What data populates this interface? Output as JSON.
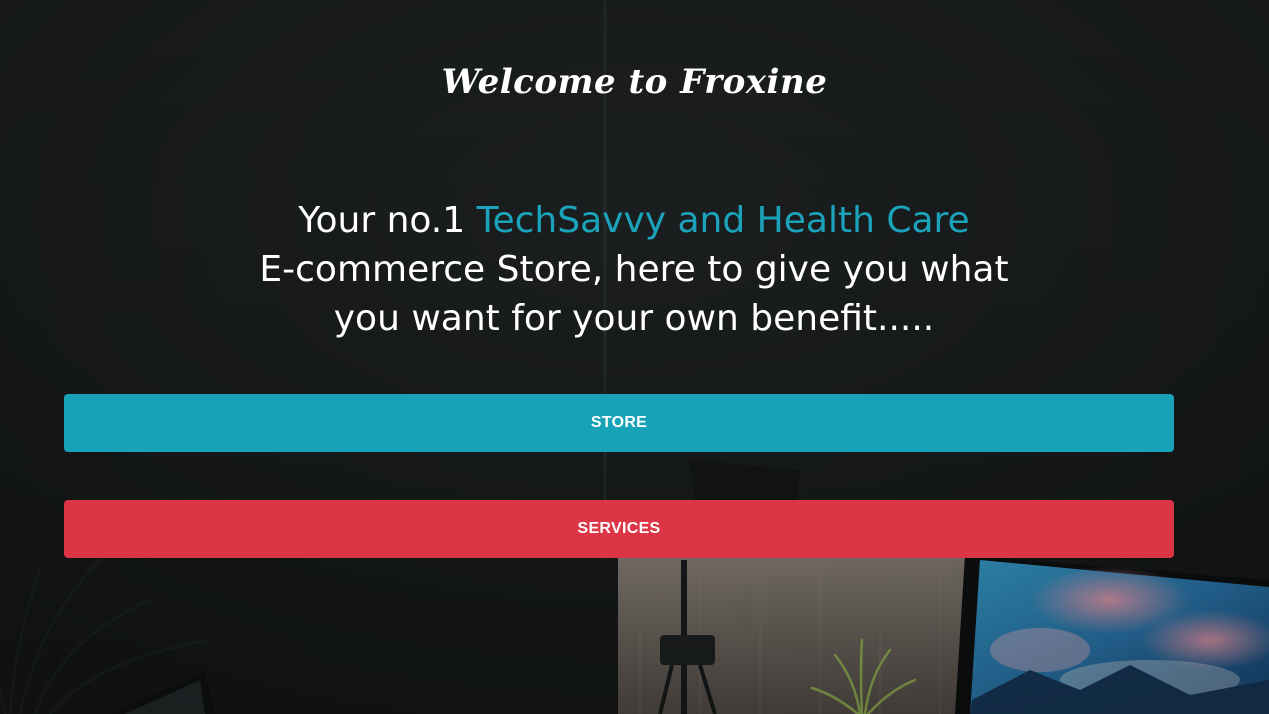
{
  "hero": {
    "welcome": "Welcome to Froxine",
    "tagline_prefix": "Your no.1 ",
    "tagline_accent": "TechSavvy and Health Care",
    "tagline_line2": "E-commerce Store, here to give you what",
    "tagline_line3": "you want for your own benefit....."
  },
  "buttons": {
    "store": "STORE",
    "services": "SERVICES"
  },
  "colors": {
    "accent": "#17a2b8",
    "danger": "#dc3545",
    "background": "#1b1e1f",
    "text": "#ffffff"
  }
}
